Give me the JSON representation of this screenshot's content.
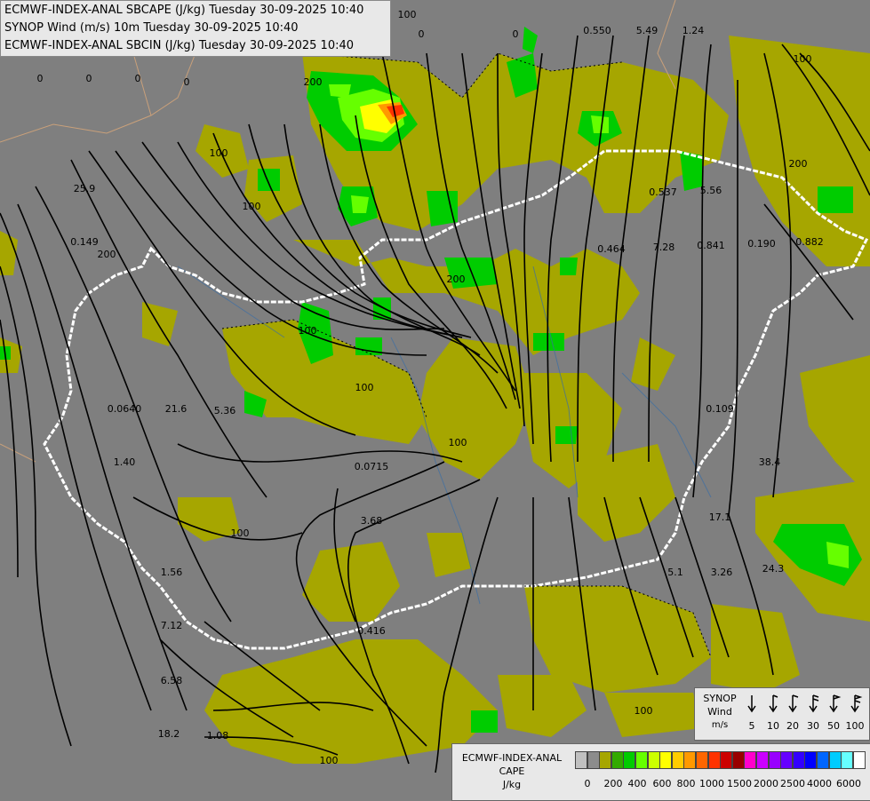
{
  "header": {
    "line1": "ECMWF-INDEX-ANAL SBCAPE (J/kg) Tuesday 30-09-2025 10:40",
    "line2": "SYNOP Wind (m/s) 10m Tuesday 30-09-2025 10:40",
    "line3": "ECMWF-INDEX-ANAL SBCIN (J/kg) Tuesday 30-09-2025 10:40"
  },
  "colors": {
    "background": "#7f7f7f",
    "cape_low": "#a6a600",
    "cape_mid": "#00cc00",
    "cape_hi": "#ffff00",
    "border": "#ffffff",
    "streamline": "#000000"
  },
  "map_labels": [
    {
      "t": "0"
    },
    {
      "t": "0"
    },
    {
      "t": "0"
    },
    {
      "t": "0"
    },
    {
      "t": "0"
    },
    {
      "t": "0"
    },
    {
      "t": "0"
    },
    {
      "t": "0"
    },
    {
      "t": "0.550"
    },
    {
      "t": "5.49"
    },
    {
      "t": "1.24"
    },
    {
      "t": "25.9"
    },
    {
      "t": "0.149"
    },
    {
      "t": "0.537"
    },
    {
      "t": "5.56"
    },
    {
      "t": "0.464"
    },
    {
      "t": "7.28"
    },
    {
      "t": "0.841"
    },
    {
      "t": "0.190"
    },
    {
      "t": "0.882"
    },
    {
      "t": "0.0640"
    },
    {
      "t": "21.6"
    },
    {
      "t": "5.36"
    },
    {
      "t": "1.40"
    },
    {
      "t": "0.0715"
    },
    {
      "t": "0.109"
    },
    {
      "t": "38.4"
    },
    {
      "t": "3.68"
    },
    {
      "t": "17.1"
    },
    {
      "t": "1.56"
    },
    {
      "t": "5.1"
    },
    {
      "t": "3.26"
    },
    {
      "t": "24.3"
    },
    {
      "t": "7.12"
    },
    {
      "t": "0.416"
    },
    {
      "t": "6.58"
    },
    {
      "t": "18.2"
    },
    {
      "t": "1.08"
    },
    {
      "t": "100"
    },
    {
      "t": "100"
    },
    {
      "t": "100"
    },
    {
      "t": "100"
    },
    {
      "t": "200"
    },
    {
      "t": "200"
    },
    {
      "t": "200"
    },
    {
      "t": "200"
    },
    {
      "t": "100"
    },
    {
      "t": "100"
    },
    {
      "t": "100"
    },
    {
      "t": "100"
    },
    {
      "t": "100"
    },
    {
      "t": "100"
    }
  ],
  "wind_legend": {
    "title_line1": "SYNOP",
    "title_line2": "Wind",
    "title_line3": "m/s",
    "speeds": [
      "5",
      "10",
      "20",
      "30",
      "50",
      "100"
    ]
  },
  "cape_legend": {
    "title_line1": "ECMWF-INDEX-ANAL",
    "title_line2": "CAPE",
    "title_line3": "J/kg",
    "swatches": [
      "#c0c0c0",
      "#8c8c8c",
      "#a6a600",
      "#33aa00",
      "#00cc00",
      "#66ff00",
      "#ccff00",
      "#ffff00",
      "#ffcc00",
      "#ff9900",
      "#ff6600",
      "#ff3300",
      "#cc0000",
      "#990000",
      "#ff00cc",
      "#cc00ff",
      "#9900ff",
      "#6600ff",
      "#3300ff",
      "#0000ff",
      "#0066ff",
      "#00ccff",
      "#66ffff",
      "#ffffff"
    ],
    "ticks": [
      "0",
      "200",
      "400",
      "600",
      "800",
      "1000",
      "1500",
      "2000",
      "2500",
      "4000",
      "6000"
    ]
  }
}
